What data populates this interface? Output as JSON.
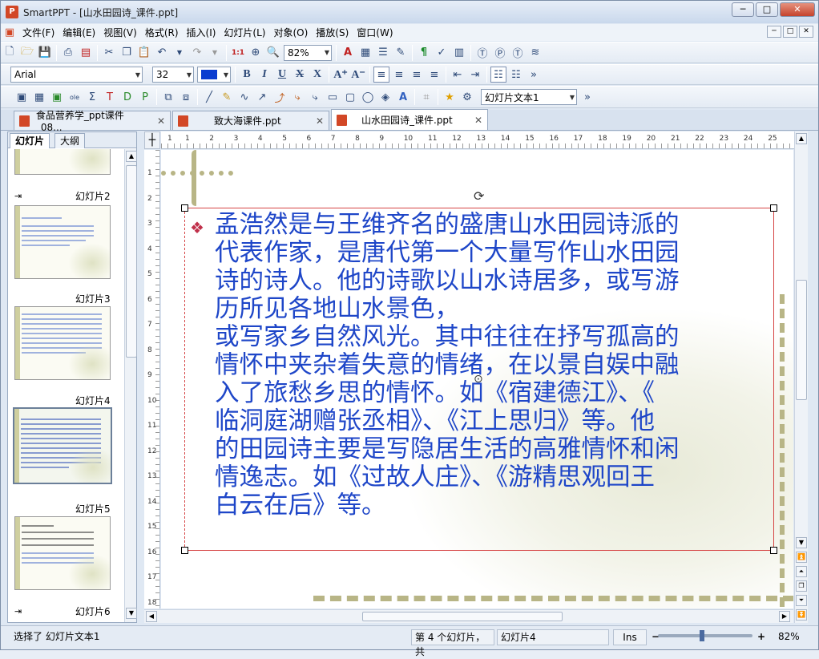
{
  "window": {
    "title": "SmartPPT - [山水田园诗_课件.ppt]",
    "app_icon": "P"
  },
  "window_controls": {
    "minimize": "─",
    "maximize": "□",
    "close": "✕"
  },
  "menu": [
    "文件(F)",
    "编辑(E)",
    "视图(V)",
    "格式(R)",
    "插入(I)",
    "幻灯片(L)",
    "对象(O)",
    "播放(S)",
    "窗口(W)"
  ],
  "toolbar": {
    "zoom_value": "82%",
    "font_name": "Arial",
    "font_size": "32",
    "object_selector": "幻灯片文本1",
    "overflow": "»"
  },
  "doc_tabs": [
    {
      "label": "食品营养学_ppt课件_08...",
      "close": "✕"
    },
    {
      "label": "致大海课件.ppt",
      "close": "✕"
    },
    {
      "label": "山水田园诗_课件.ppt",
      "close": "✕"
    }
  ],
  "panel_tabs": {
    "slides": "幻灯片",
    "outline": "大纲"
  },
  "slides": [
    {
      "label": "幻灯片2"
    },
    {
      "label": "幻灯片3"
    },
    {
      "label": "幻灯片4"
    },
    {
      "label": "幻灯片5"
    },
    {
      "label": "幻灯片6"
    }
  ],
  "ruler_h": [
    "1",
    "1",
    "2",
    "3",
    "4",
    "5",
    "6",
    "7",
    "8",
    "9",
    "10",
    "11",
    "12",
    "13",
    "14",
    "15",
    "16",
    "17",
    "18",
    "19",
    "20",
    "21",
    "22",
    "23",
    "24",
    "25"
  ],
  "ruler_v": [
    "1",
    "2",
    "3",
    "4",
    "5",
    "6",
    "7",
    "8",
    "9",
    "10",
    "11",
    "12",
    "13",
    "14",
    "15",
    "16",
    "17",
    "18"
  ],
  "slide_body": "孟浩然是与王维齐名的盛唐山水田园诗派的\n代表作家，是唐代第一个大量写作山水田园\n诗的诗人。他的诗歌以山水诗居多，或写游\n历所见各地山水景色，\n或写家乡自然风光。其中往往在抒写孤高的\n情怀中夹杂着失意的情绪，在以景自娱中融\n入了旅愁乡思的情怀。如《宿建德江》、《\n临洞庭湖赠张丞相》、《江上思归》等。他\n的田园诗主要是写隐居生活的高雅情怀和闲\n情逸志。如《过故人庄》、《游精思观回王\n白云在后》等。",
  "bullet_glyph": "❖",
  "status": {
    "selection": "选择了 幻灯片文本1",
    "position": "第 4 个幻灯片，共",
    "slide_name": "幻灯片4",
    "ins": "Ins",
    "zoom": "82%",
    "zoom_minus": "−",
    "zoom_plus": "+"
  },
  "colors": {
    "text_blue": "#1e46c8",
    "bullet": "#c0304a",
    "selection_border": "#d64545",
    "font_color_swatch": "#0a3cd0"
  }
}
